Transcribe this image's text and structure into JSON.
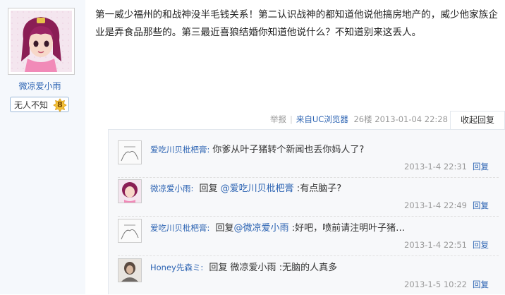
{
  "author": {
    "name": "微凉爱小雨",
    "badge_label": "无人不知",
    "level": "8"
  },
  "post": {
    "content": "第一威少福州的和战神没半毛钱关系！第二认识战神的都知道他说他搞房地产的，威少他家族企业是弄食品那些的。第三最近喜狼结婚你知道他说什么？不知道别来这丢人。",
    "report": "举报",
    "source": "来自UC浏览器",
    "floor": "26楼",
    "time": "2013-01-04 22:28",
    "collapse_label": "收起回复"
  },
  "replies": [
    {
      "user": "爱吃川贝枇杷膏:",
      "prefix": "",
      "mention": "",
      "text": "你爹从叶子猪转个新闻也丢你妈人了?",
      "time": "2013-1-4 22:31",
      "reply_label": "回复"
    },
    {
      "user": "微凉爱小雨:",
      "prefix": "回复",
      "mention": "@爱吃川贝枇杷膏",
      "text": ":有点脑子?",
      "time": "2013-1-4 22:49",
      "reply_label": "回复"
    },
    {
      "user": "爱吃川贝枇杷膏:",
      "prefix": "回复",
      "mention": "@微凉爱小雨",
      "text": ":好吧，喷前请注明叶子猪…",
      "time": "2013-1-4 22:51",
      "reply_label": "回复"
    },
    {
      "user": "Honey先森ミ:",
      "prefix": "回复",
      "mention": "微凉爱小雨",
      "text": ":无脑的人真多",
      "time": "2013-1-5 10:22",
      "reply_label": "回复"
    }
  ],
  "colors": {
    "link": "#2d64b3",
    "meta": "#999999",
    "sidebar": "#f5f8fc",
    "level_star": "#f3c13a"
  }
}
